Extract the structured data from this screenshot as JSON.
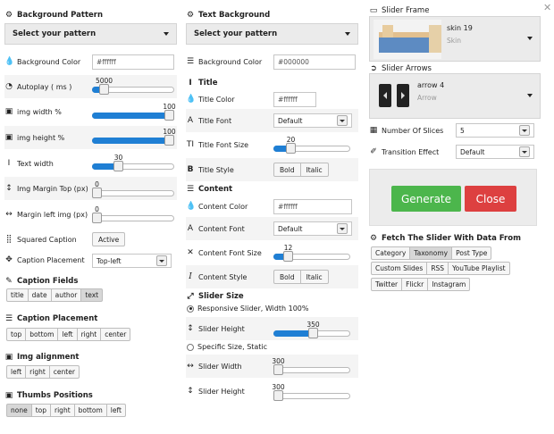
{
  "col1": {
    "bg_pattern": {
      "heading": "Background Pattern",
      "select": "Select your pattern"
    },
    "bg_color": {
      "label": "Background Color",
      "value": "#ffffff"
    },
    "autoplay": {
      "label": "Autoplay ( ms )",
      "value": "5000",
      "fraction": 0.1
    },
    "img_width": {
      "label": "img width %",
      "value": "100",
      "fraction": 1.0
    },
    "img_height": {
      "label": "img height %",
      "value": "100",
      "fraction": 1.0
    },
    "text_width": {
      "label": "Text width",
      "value": "30",
      "fraction": 0.3
    },
    "img_margin_top": {
      "label": "Img Margin Top (px)",
      "value": "0",
      "fraction": 0.0
    },
    "margin_left_img": {
      "label": "Margin left img (px)",
      "value": "0",
      "fraction": 0.0
    },
    "squared_caption": {
      "label": "Squared Caption",
      "button": "Active"
    },
    "caption_placement_row": {
      "label": "Caption Placement",
      "value": "Top-left"
    },
    "caption_fields": {
      "heading": "Caption Fields",
      "buttons": [
        "title",
        "date",
        "author",
        "text"
      ]
    },
    "caption_placement": {
      "heading": "Caption Placement",
      "buttons": [
        "top",
        "bottom",
        "left",
        "right",
        "center"
      ]
    },
    "img_alignment": {
      "heading": "Img alignment",
      "buttons": [
        "left",
        "right",
        "center"
      ]
    },
    "thumbs_positions": {
      "heading": "Thumbs Positions",
      "buttons": [
        "none",
        "top",
        "right",
        "bottom",
        "left"
      ]
    }
  },
  "col2": {
    "text_bg": {
      "heading": "Text Background",
      "select": "Select your pattern"
    },
    "bg_color": {
      "label": "Background Color",
      "value": "#000000"
    },
    "title": {
      "heading": "Title"
    },
    "title_color": {
      "label": "Title Color",
      "value": "#ffffff"
    },
    "title_font": {
      "label": "Title Font",
      "value": "Default"
    },
    "title_font_size": {
      "label": "Title Font Size",
      "value": "20",
      "fraction": 0.18
    },
    "title_style": {
      "label": "Title Style",
      "buttons": [
        "Bold",
        "Italic"
      ]
    },
    "content": {
      "heading": "Content"
    },
    "content_color": {
      "label": "Content Color",
      "value": "#ffffff"
    },
    "content_font": {
      "label": "Content Font",
      "value": "Default"
    },
    "content_font_size": {
      "label": "Content Font Size",
      "value": "12",
      "fraction": 0.15
    },
    "content_style": {
      "label": "Content Style",
      "buttons": [
        "Bold",
        "Italic"
      ]
    },
    "slider_size": {
      "heading": "Slider Size"
    },
    "responsive": {
      "label": "Responsive Slider, Width 100%"
    },
    "slider_height1": {
      "label": "Slider Height",
      "value": "350",
      "fraction": 0.52
    },
    "specific": {
      "label": "Specific Size, Static"
    },
    "slider_width": {
      "label": "Slider Width",
      "value": "300",
      "fraction": 0.0
    },
    "slider_height2": {
      "label": "Slider Height",
      "value": "300",
      "fraction": 0.0
    }
  },
  "col3": {
    "frame": {
      "heading": "Slider Frame",
      "name": "skin 19",
      "sub": "Skin"
    },
    "arrows": {
      "heading": "Slider Arrows",
      "name": "arrow 4",
      "sub": "Arrow"
    },
    "slices": {
      "label": "Number Of Slices",
      "value": "5"
    },
    "transition": {
      "label": "Transition Effect",
      "value": "Default"
    },
    "generate": "Generate",
    "close": "Close",
    "fetch": {
      "heading": "Fetch The Slider With Data From",
      "rows": [
        [
          "Category",
          "Taxonomy",
          "Post Type"
        ],
        [
          "Custom Slides",
          "RSS",
          "YouTube Playlist"
        ],
        [
          "Twitter",
          "Flickr",
          "Instagram"
        ]
      ]
    }
  },
  "colors": {
    "accent": "#1f7fd4",
    "generate": "#4cb64c",
    "close": "#dd4040"
  },
  "icons": [
    "gear-icon",
    "droplet-icon",
    "speedometer-icon",
    "image-icon",
    "text-width-icon",
    "vertical-arrows-icon",
    "horizontal-arrows-icon",
    "grid-icon",
    "move-icon",
    "magic-icon",
    "list-icon",
    "text-size-icon",
    "bold-icon",
    "italic-icon",
    "font-icon",
    "resize-icon",
    "frame-icon",
    "arrow-circle-icon",
    "random-icon",
    "close-icon"
  ]
}
